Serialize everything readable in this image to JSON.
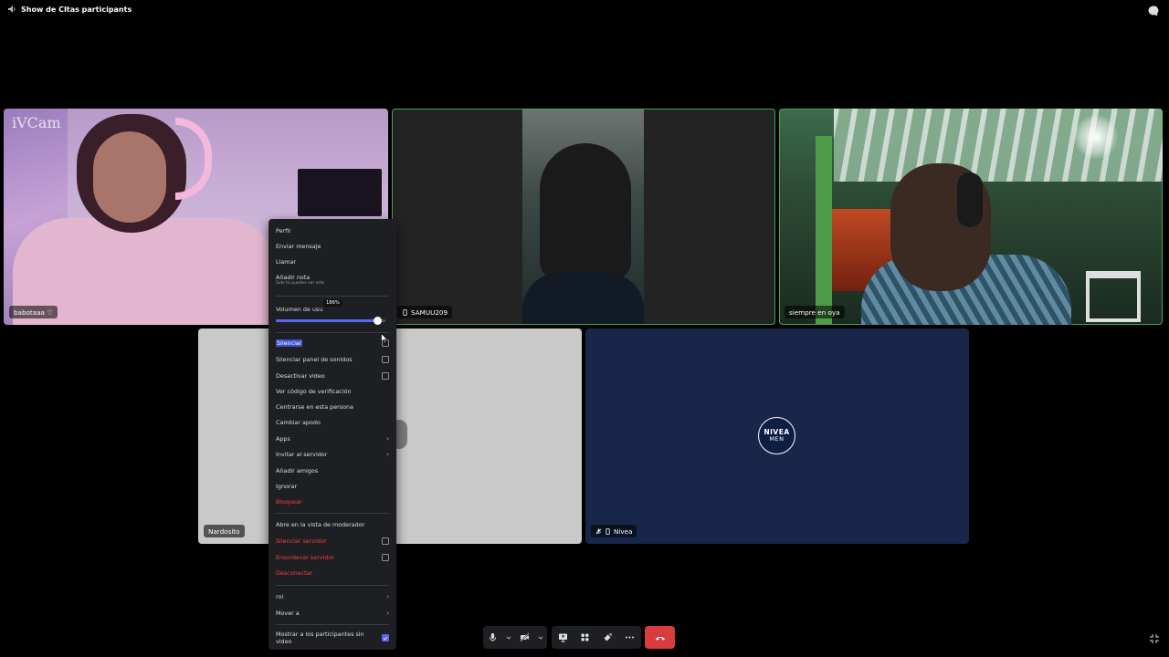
{
  "window": {
    "title": "Show de CItas participants"
  },
  "participants": [
    {
      "name": "babotaaa ♡",
      "watermark": "iVCam"
    },
    {
      "name": "SAMUU209"
    },
    {
      "name": "siempre en oya"
    },
    {
      "name": "Nardosito"
    },
    {
      "name": "Nivea",
      "logo_line1": "NIVEA",
      "logo_line2": "MEN"
    }
  ],
  "context_menu": {
    "profile": "Perfil",
    "send_message": "Enviar mensaje",
    "call": "Llamar",
    "add_note": "Añadir nota",
    "add_note_hint": "Solo tú puedes ver esto",
    "volume_label": "Volumen de usu",
    "volume_value": "186%",
    "volume_fraction": 0.93,
    "mute": "Silenciar",
    "mute_soundboard": "Silenciar panel de sonidos",
    "disable_video": "Desactivar video",
    "verify_code": "Ver código de verificación",
    "focus_person": "Centrarse en esta persona",
    "change_nickname": "Cambiar apodo",
    "apps": "Apps",
    "invite_server": "Invitar al servidor",
    "add_friends": "Añadir amigos",
    "ignore": "Ignorar",
    "block": "Bloquear",
    "open_moderator": "Abre en la vista de moderador",
    "server_mute": "Silenciar servidor",
    "server_deafen": "Ensordecer servidor",
    "disconnect": "Desconectar",
    "role": "rol",
    "move_to": "Mover a",
    "show_no_video": "Mostrar a los participantes sin video",
    "show_no_video_checked": true
  },
  "colors": {
    "speaking_border": "#3ba55d",
    "danger": "#f23f43",
    "accent": "#5865f2",
    "hangup": "#d83c3e"
  },
  "icons": {
    "title": "speaker-icon",
    "chat": "chat-bubble-icon",
    "mic": "microphone-icon",
    "camera": "camera-off-icon",
    "screen_share": "screen-share-icon",
    "activities": "activities-icon",
    "soundboard": "soundboard-icon",
    "more": "more-icon",
    "hangup": "hangup-icon",
    "fullscreen": "exit-fullscreen-icon"
  }
}
